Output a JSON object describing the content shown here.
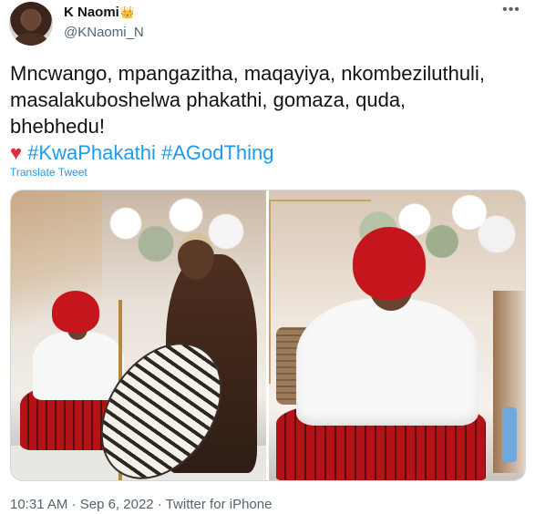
{
  "author": {
    "display_name": "K Naomi",
    "handle": "@KNaomi_N",
    "crown_emoji": "👑"
  },
  "more_icon": "more-horizontal-icon",
  "tweet": {
    "text_lines": [
      "Mncwango, mpangazitha, maqayiya, nkombeziluthuli,",
      "masalakuboshelwa phakathi, gomaza, quda,",
      "bhebhedu!"
    ],
    "heart_emoji": "♥",
    "hashtags": [
      "#KwaPhakathi",
      "#AGodThing"
    ]
  },
  "translate_label": "Translate Tweet",
  "meta": {
    "time": "10:31 AM",
    "separator": "·",
    "date": "Sep 6, 2022",
    "source": "Twitter for iPhone"
  },
  "colors": {
    "link": "#1d9bf0",
    "text": "#0f1419",
    "muted": "#536471",
    "heart": "#dd2e44"
  }
}
